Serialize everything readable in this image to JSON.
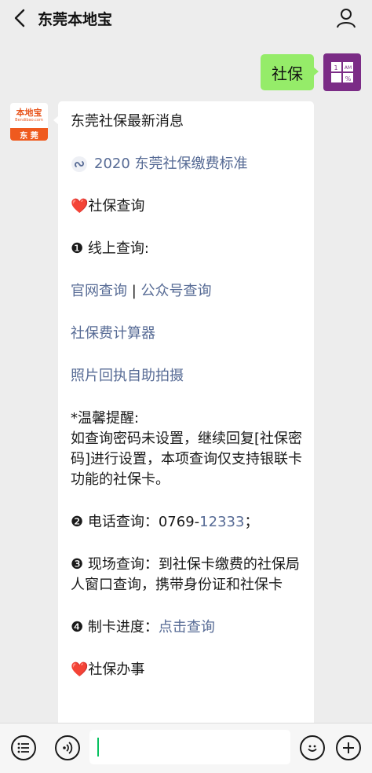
{
  "header": {
    "title": "东莞本地宝"
  },
  "outgoing": {
    "text": "社保",
    "avatar_lines": [
      "1",
      "AM",
      "%"
    ]
  },
  "incoming": {
    "avatar_logo": "本地宝",
    "avatar_sub": "Bendibao.com",
    "avatar_city": "东 莞",
    "title": "东莞社保最新消息",
    "mini_link": "2020 东莞社保缴费标准",
    "section1_heading": "社保查询",
    "item1_label": "❶ 线上查询:",
    "link_official": "官网查询",
    "link_sep": " | ",
    "link_public": "公众号查询",
    "link_calculator": "社保费计算器",
    "link_photo": "照片回执自助拍摄",
    "reminder_title": "*温馨提醒:",
    "reminder_body": "如查询密码未设置，继续回复[社保密码]进行设置，本项查询仅支持银联卡功能的社保卡。",
    "item2_label": "❷ 电话查询：0769-",
    "item2_number": "12333",
    "item2_suffix": "；",
    "item3_text": "❸ 现场查询：到社保卡缴费的社保局人窗口查询，携带身份证和社保卡",
    "item4_label": "❹ 制卡进度：",
    "item4_link": "点击查询",
    "section2_heading": "社保办事"
  },
  "input": {
    "placeholder": ""
  },
  "colors": {
    "background": "#ededed",
    "outgoing_bubble": "#95ec69",
    "link": "#576b95",
    "caret": "#07c160",
    "avatar_purple": "#7b2c86",
    "brand_orange": "#ef5a1e"
  },
  "icons": {
    "back": "chevron-left-icon",
    "user": "person-icon",
    "menu": "list-icon",
    "voice": "voice-icon",
    "emoji": "emoji-icon",
    "add": "plus-icon",
    "mini_program": "mini-program-icon",
    "heart": "heart-icon"
  }
}
